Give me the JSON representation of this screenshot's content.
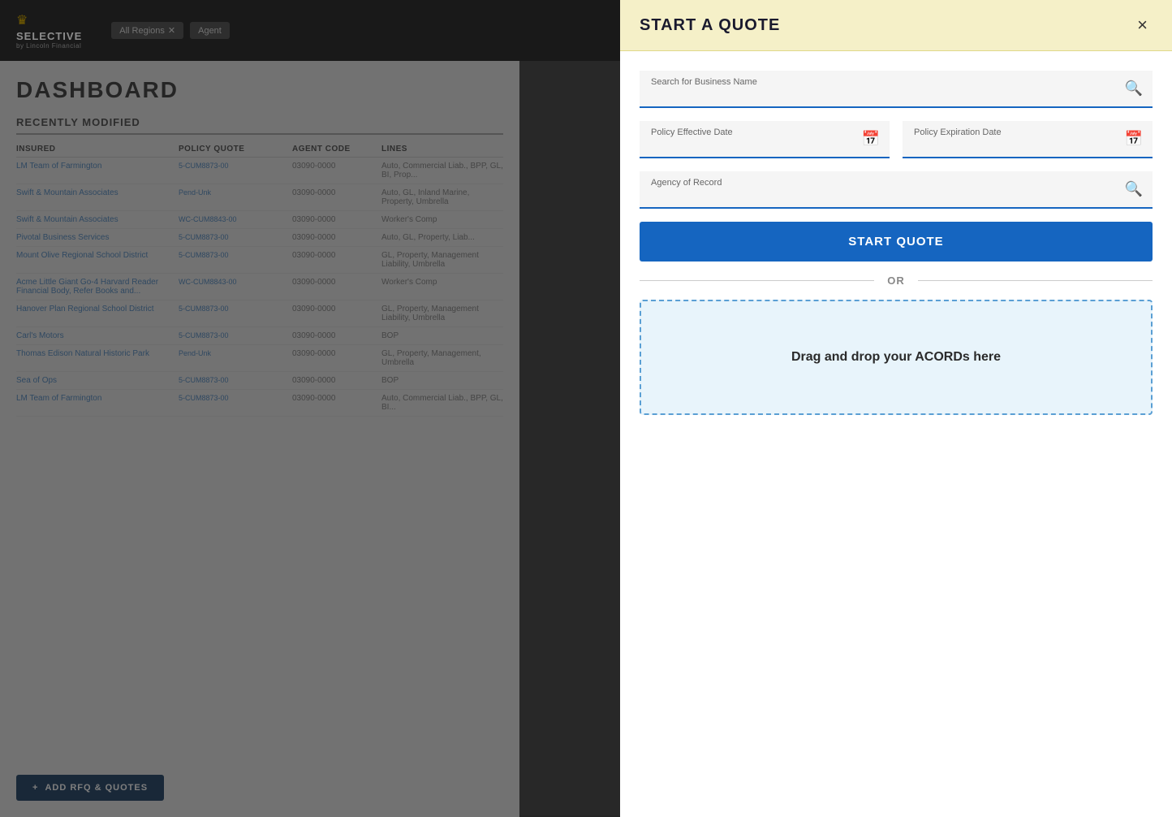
{
  "header": {
    "logo": "SELECTIVE",
    "logo_sub": "by Lincoln Financial",
    "tags": [
      {
        "label": "All Regions",
        "removable": true
      },
      {
        "label": "Agent"
      }
    ]
  },
  "dashboard": {
    "title": "DASHBOARD",
    "recently_modified": "RECENTLY MODIFIED",
    "table": {
      "columns": [
        "INSURED",
        "POLICY QUOTE",
        "AGENT CODE",
        "LINES"
      ],
      "rows": [
        {
          "insured": "LM Team of Farmington",
          "policy": "5-CUM8873-00",
          "agent": "03090-0000",
          "lines": "Auto, Commercial Liab., BPP, GL, BI, Prop..."
        },
        {
          "insured": "Swift & Mountain Associates",
          "policy": "Pend-Unk",
          "agent": "03090-0000",
          "lines": "Auto, GL, Inland Marine, Property, Umbrella"
        },
        {
          "insured": "Swift & Mountain Associates",
          "policy": "WC-CUM8843-00",
          "agent": "03090-0000",
          "lines": "Worker's Comp"
        },
        {
          "insured": "Pivotal Business Services",
          "policy": "5-CUM8873-00",
          "agent": "03090-0000",
          "lines": "Auto, GL, Property, Liab..."
        },
        {
          "insured": "Mount Olive Regional School District",
          "policy": "5-CUM8873-00",
          "agent": "03090-0000",
          "lines": "GL, Property, Management Liability, Umbrella"
        },
        {
          "insured": "Acme Little Giant Go-4 Harvard Reader Financial Body, Refer Books and...",
          "policy": "WC-CUM8843-00",
          "agent": "03090-0000",
          "lines": "Worker's Comp"
        },
        {
          "insured": "Hanover Plan Regional School District",
          "policy": "5-CUM8873-00",
          "agent": "03090-0000",
          "lines": "GL, Property, Management Liability, Umbrella"
        },
        {
          "insured": "Carl's Motors",
          "policy": "5-CUM8873-00",
          "agent": "03090-0000",
          "lines": "BOP"
        },
        {
          "insured": "Thomas Edison Natural Historic Park",
          "policy": "Pend-Unk",
          "agent": "03090-0000",
          "lines": "GL, Property, Management, Umbrella"
        },
        {
          "insured": "Sea of Ops",
          "policy": "5-CUM8873-00",
          "agent": "03090-0000",
          "lines": "BOP"
        },
        {
          "insured": "LM Team of Farmington",
          "policy": "5-CUM8873-00",
          "agent": "03090-0000",
          "lines": "Auto, Commercial Liab., BPP, GL, BI..."
        }
      ]
    },
    "add_rfq_label": "ADD RFQ & QUOTES",
    "add_rfq_icon": "+"
  },
  "modal": {
    "title": "START A QUOTE",
    "close_label": "×",
    "business_name_label": "Search for Business Name",
    "business_name_placeholder": "",
    "effective_date_label": "Policy Effective Date",
    "expiration_date_label": "Policy Expiration Date",
    "agency_label": "Agency of Record",
    "agency_placeholder": "",
    "start_quote_label": "START QUOTE",
    "or_label": "OR",
    "drag_drop_label": "Drag and drop your ACORDs here"
  }
}
